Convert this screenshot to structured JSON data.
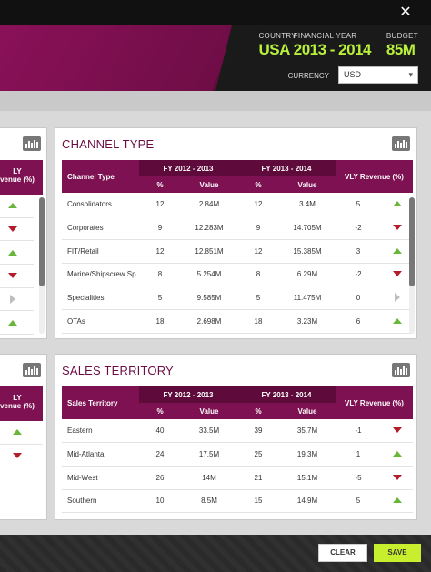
{
  "header": {
    "kpis": [
      {
        "label": "COUNTRY",
        "value": "USA"
      },
      {
        "label": "FINANCIAL YEAR",
        "value": "2013 - 2014"
      },
      {
        "label": "BUDGET",
        "value": "85M"
      }
    ],
    "currency_label": "CURRENCY",
    "currency_value": "USD"
  },
  "channel": {
    "title": "CHANNEL TYPE",
    "col_name": "Channel Type",
    "fy1": "FY 2012 - 2013",
    "fy2": "FY 2013 - 2014",
    "vly": "VLY Revenue (%)",
    "pct": "%",
    "value": "Value",
    "rows": [
      {
        "name": "Consolidators",
        "p1": "12",
        "v1": "2.84M",
        "p2": "12",
        "v2": "3.4M",
        "vly": "5",
        "trend": "up"
      },
      {
        "name": "Corporates",
        "p1": "9",
        "v1": "12.283M",
        "p2": "9",
        "v2": "14.705M",
        "vly": "-2",
        "trend": "down"
      },
      {
        "name": "FIT/Retail",
        "p1": "12",
        "v1": "12.851M",
        "p2": "12",
        "v2": "15.385M",
        "vly": "3",
        "trend": "up"
      },
      {
        "name": "Marine/Shipscrew Sp",
        "p1": "8",
        "v1": "5.254M",
        "p2": "8",
        "v2": "6.29M",
        "vly": "-2",
        "trend": "down"
      },
      {
        "name": "Specialities",
        "p1": "5",
        "v1": "9.585M",
        "p2": "5",
        "v2": "11.475M",
        "vly": "0",
        "trend": "flat"
      },
      {
        "name": "OTAs",
        "p1": "18",
        "v1": "2.698M",
        "p2": "18",
        "v2": "3.23M",
        "vly": "6",
        "trend": "up"
      }
    ]
  },
  "territory": {
    "title": "SALES TERRITORY",
    "col_name": "Sales Territory",
    "fy1": "FY 2012 - 2013",
    "fy2": "FY 2013 - 2014",
    "vly": "VLY Revenue (%)",
    "pct": "%",
    "value": "Value",
    "rows": [
      {
        "name": "Eastern",
        "p1": "40",
        "v1": "33.5M",
        "p2": "39",
        "v2": "35.7M",
        "vly": "-1",
        "trend": "down"
      },
      {
        "name": "Mid-Atlanta",
        "p1": "24",
        "v1": "17.5M",
        "p2": "25",
        "v2": "19.3M",
        "vly": "1",
        "trend": "up"
      },
      {
        "name": "Mid-West",
        "p1": "26",
        "v1": "14M",
        "p2": "21",
        "v2": "15.1M",
        "vly": "-5",
        "trend": "down"
      },
      {
        "name": "Southern",
        "p1": "10",
        "v1": "8.5M",
        "p2": "15",
        "v2": "14.9M",
        "vly": "5",
        "trend": "up"
      }
    ]
  },
  "left_partial": {
    "top": {
      "hdr1": "LY",
      "hdr2": "venue (%)",
      "trends": [
        "up",
        "down",
        "up",
        "down",
        "flat",
        "up"
      ]
    },
    "bottom": {
      "hdr1": "LY",
      "hdr2": "venue (%)",
      "trends": [
        "up",
        "down"
      ]
    }
  },
  "footer": {
    "clear": "CLEAR",
    "save": "SAVE"
  },
  "colors": {
    "brand": "#7e1152",
    "accent": "#b8f03c",
    "up": "#6ab63a",
    "down": "#b21d2a"
  }
}
